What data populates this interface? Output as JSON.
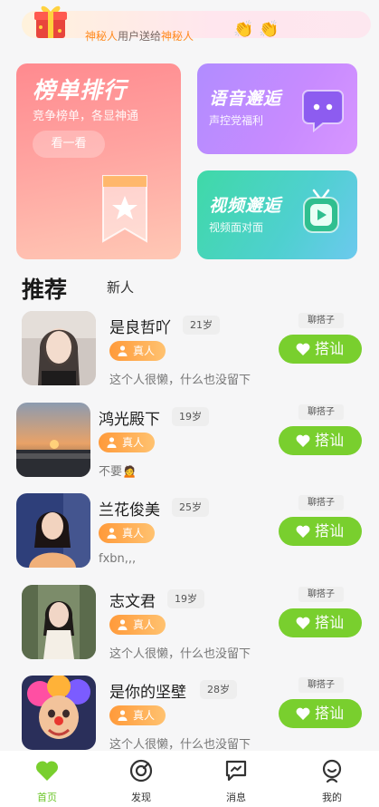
{
  "banner": {
    "highlight1": "神秘人",
    "middle": "用户送给",
    "highlight2": "神秘人"
  },
  "cards": {
    "rank": {
      "title": "榜单排行",
      "subtitle": "竞争榜单，各显神通",
      "button": "看一看"
    },
    "voice": {
      "title": "语音邂逅",
      "subtitle": "声控党福利"
    },
    "video": {
      "title": "视频邂逅",
      "subtitle": "视频面对面"
    }
  },
  "tabs": {
    "recommend": "推荐",
    "new": "新人"
  },
  "users": [
    {
      "name": "是良哲吖",
      "age": "21岁",
      "tag": "真人",
      "bio": "这个人很懒，什么也没留下",
      "badge": "聊搭子",
      "action": "搭讪"
    },
    {
      "name": "鸿光殿下",
      "age": "19岁",
      "tag": "真人",
      "bio": "不要🙍",
      "badge": "聊搭子",
      "action": "搭讪"
    },
    {
      "name": "兰花俊美",
      "age": "25岁",
      "tag": "真人",
      "bio": "fxbn,,,",
      "badge": "聊搭子",
      "action": "搭讪"
    },
    {
      "name": "志文君",
      "age": "19岁",
      "tag": "真人",
      "bio": "这个人很懒，什么也没留下",
      "badge": "聊搭子",
      "action": "搭讪"
    },
    {
      "name": "是你的坚壁",
      "age": "28岁",
      "tag": "真人",
      "bio": "这个人很懒，什么也没留下",
      "badge": "聊搭子",
      "action": "搭讪"
    }
  ],
  "nav": [
    {
      "label": "首页",
      "icon": "heart-icon",
      "active": true
    },
    {
      "label": "发现",
      "icon": "compass-icon",
      "active": false
    },
    {
      "label": "消息",
      "icon": "message-icon",
      "active": false
    },
    {
      "label": "我的",
      "icon": "profile-icon",
      "active": false
    }
  ],
  "colors": {
    "accent_green": "#79cf2e",
    "tag_orange": "#ff9a3a"
  }
}
